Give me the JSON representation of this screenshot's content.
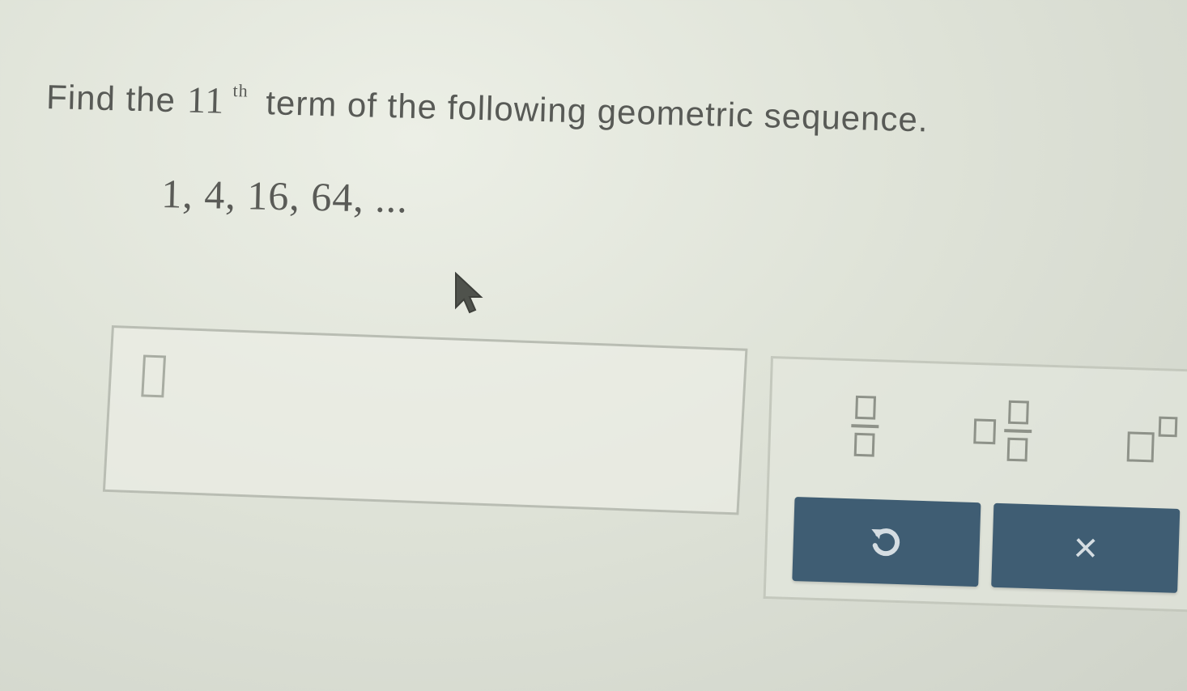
{
  "question": {
    "prefix": "Find the",
    "term_number": "11",
    "term_suffix": "th",
    "rest": "term of the following geometric sequence."
  },
  "sequence": {
    "text": "1, 4, 16, 64, ..."
  },
  "answer": {
    "value": ""
  },
  "keypad": {
    "keys": [
      {
        "name": "fraction",
        "icon": "fraction-template-icon"
      },
      {
        "name": "mixed-number",
        "icon": "mixed-number-template-icon"
      },
      {
        "name": "exponent",
        "icon": "exponent-template-icon"
      }
    ],
    "undo_icon": "undo-icon",
    "clear_label": "×"
  },
  "colors": {
    "button_bg": "#3f5d73",
    "button_fg": "#d5dde2",
    "background": "#dfe3d8"
  }
}
